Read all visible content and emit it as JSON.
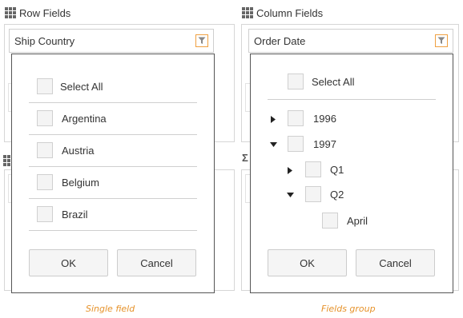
{
  "row_fields": {
    "header": "Row Fields",
    "field_label": "Ship Country",
    "popup": {
      "select_all": "Select All",
      "items": [
        "Argentina",
        "Austria",
        "Belgium",
        "Brazil"
      ],
      "ok": "OK",
      "cancel": "Cancel"
    },
    "caption": "Single field"
  },
  "column_fields": {
    "header": "Column Fields",
    "field_label": "Order Date",
    "popup": {
      "select_all": "Select All",
      "tree": [
        {
          "label": "1996",
          "expanded": false
        },
        {
          "label": "1997",
          "expanded": true
        },
        {
          "label": "Q1",
          "expanded": false
        },
        {
          "label": "Q2",
          "expanded": true
        },
        {
          "label": "April"
        }
      ],
      "ok": "OK",
      "cancel": "Cancel"
    },
    "caption": "Fields group"
  },
  "icons": {
    "grid": "grid-icon",
    "filter": "filter-icon",
    "expand": "triangle-right-icon",
    "collapse": "triangle-down-icon",
    "sigma": "sigma-icon"
  },
  "colors": {
    "accent": "#e6922a",
    "filter_border": "#f0a040"
  }
}
